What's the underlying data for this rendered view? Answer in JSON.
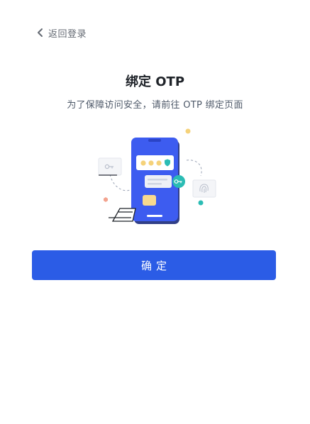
{
  "nav": {
    "back_label": "返回登录",
    "back_icon": "chevron-left-icon"
  },
  "main": {
    "title": "绑定 OTP",
    "subtitle": "为了保障访问安全，请前往 OTP 绑定页面",
    "illustration_icon": "phone-otp-illustration"
  },
  "actions": {
    "confirm_label": "确定"
  },
  "colors": {
    "primary": "#2b5ce6",
    "phone": "#3d5cf0",
    "key_badge": "#2bbcb4",
    "dot": "#f5d27a"
  }
}
